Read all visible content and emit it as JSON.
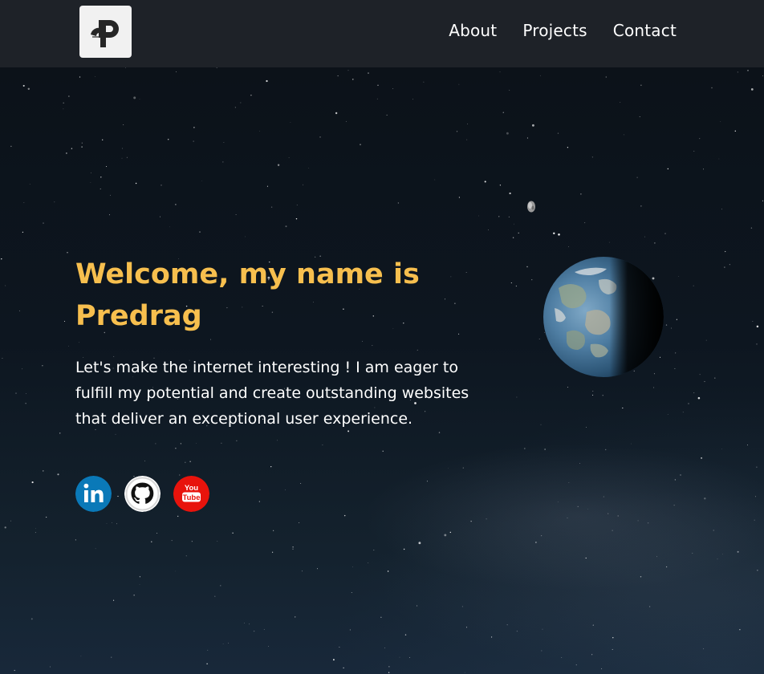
{
  "header": {
    "logo_alt": "P logo",
    "nav": {
      "about": "About",
      "projects": "Projects",
      "contact": "Contact"
    }
  },
  "hero": {
    "headline_line1": "Welcome, my name is",
    "headline_line2": "Predrag",
    "intro": "Let's make the internet interesting ! I am eager to fulfill my potential and create outstanding websites that deliver an exceptional user experience.",
    "socials": [
      {
        "name": "LinkedIn",
        "icon": "linkedin-icon",
        "color": "#0a79b8"
      },
      {
        "name": "GitHub",
        "icon": "github-icon",
        "color": "#ffffff"
      },
      {
        "name": "YouTube",
        "icon": "youtube-icon",
        "color": "#e8130c"
      }
    ]
  },
  "colors": {
    "header_bg": "#1e2228",
    "headline": "#f7bf4e",
    "text": "#ffffff"
  }
}
